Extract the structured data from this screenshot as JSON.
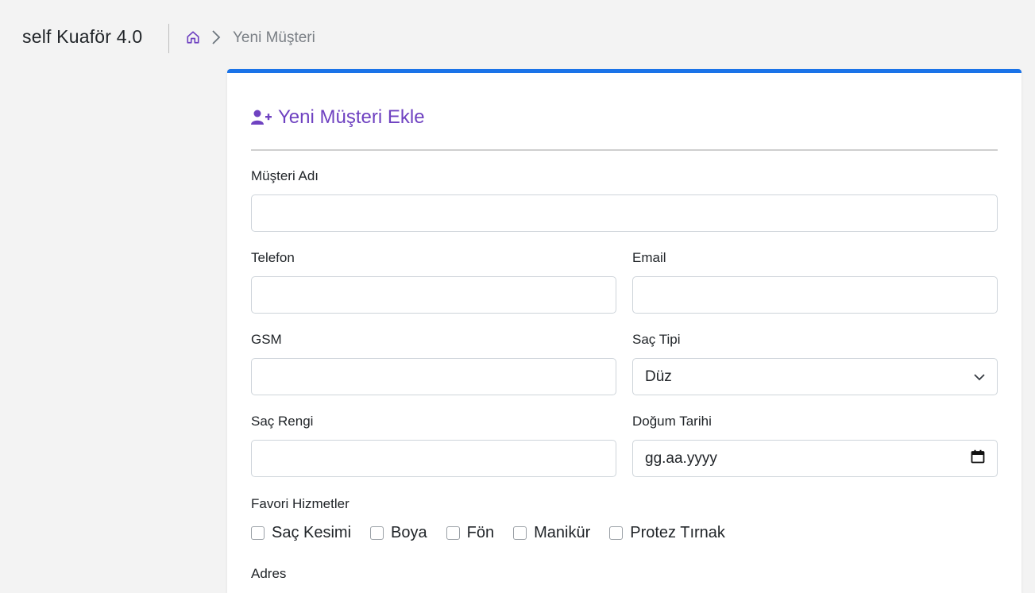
{
  "app": {
    "brand": "self Kuaför 4.0"
  },
  "breadcrumb": {
    "home_icon": "home-icon",
    "separator_icon": "chevron-right-icon",
    "current": "Yeni Müşteri"
  },
  "form": {
    "title": "Yeni Müşteri Ekle",
    "title_icon": "user-plus-icon",
    "accent_color": "#1a73e8",
    "title_color": "#6f42c1",
    "fields": {
      "name": {
        "label": "Müşteri Adı",
        "value": ""
      },
      "phone": {
        "label": "Telefon",
        "value": ""
      },
      "email": {
        "label": "Email",
        "value": ""
      },
      "gsm": {
        "label": "GSM",
        "value": ""
      },
      "hair_type": {
        "label": "Saç Tipi",
        "value": "Düz"
      },
      "hair_color": {
        "label": "Saç Rengi",
        "value": ""
      },
      "birth_date": {
        "label": "Doğum Tarihi",
        "placeholder": "gg.aa.yyyy"
      },
      "address": {
        "label": "Adres"
      }
    },
    "favorites": {
      "label": "Favori Hizmetler",
      "options": [
        {
          "label": "Saç Kesimi",
          "checked": false
        },
        {
          "label": "Boya",
          "checked": false
        },
        {
          "label": "Fön",
          "checked": false
        },
        {
          "label": "Manikür",
          "checked": false
        },
        {
          "label": "Protez Tırnak",
          "checked": false
        }
      ]
    }
  }
}
